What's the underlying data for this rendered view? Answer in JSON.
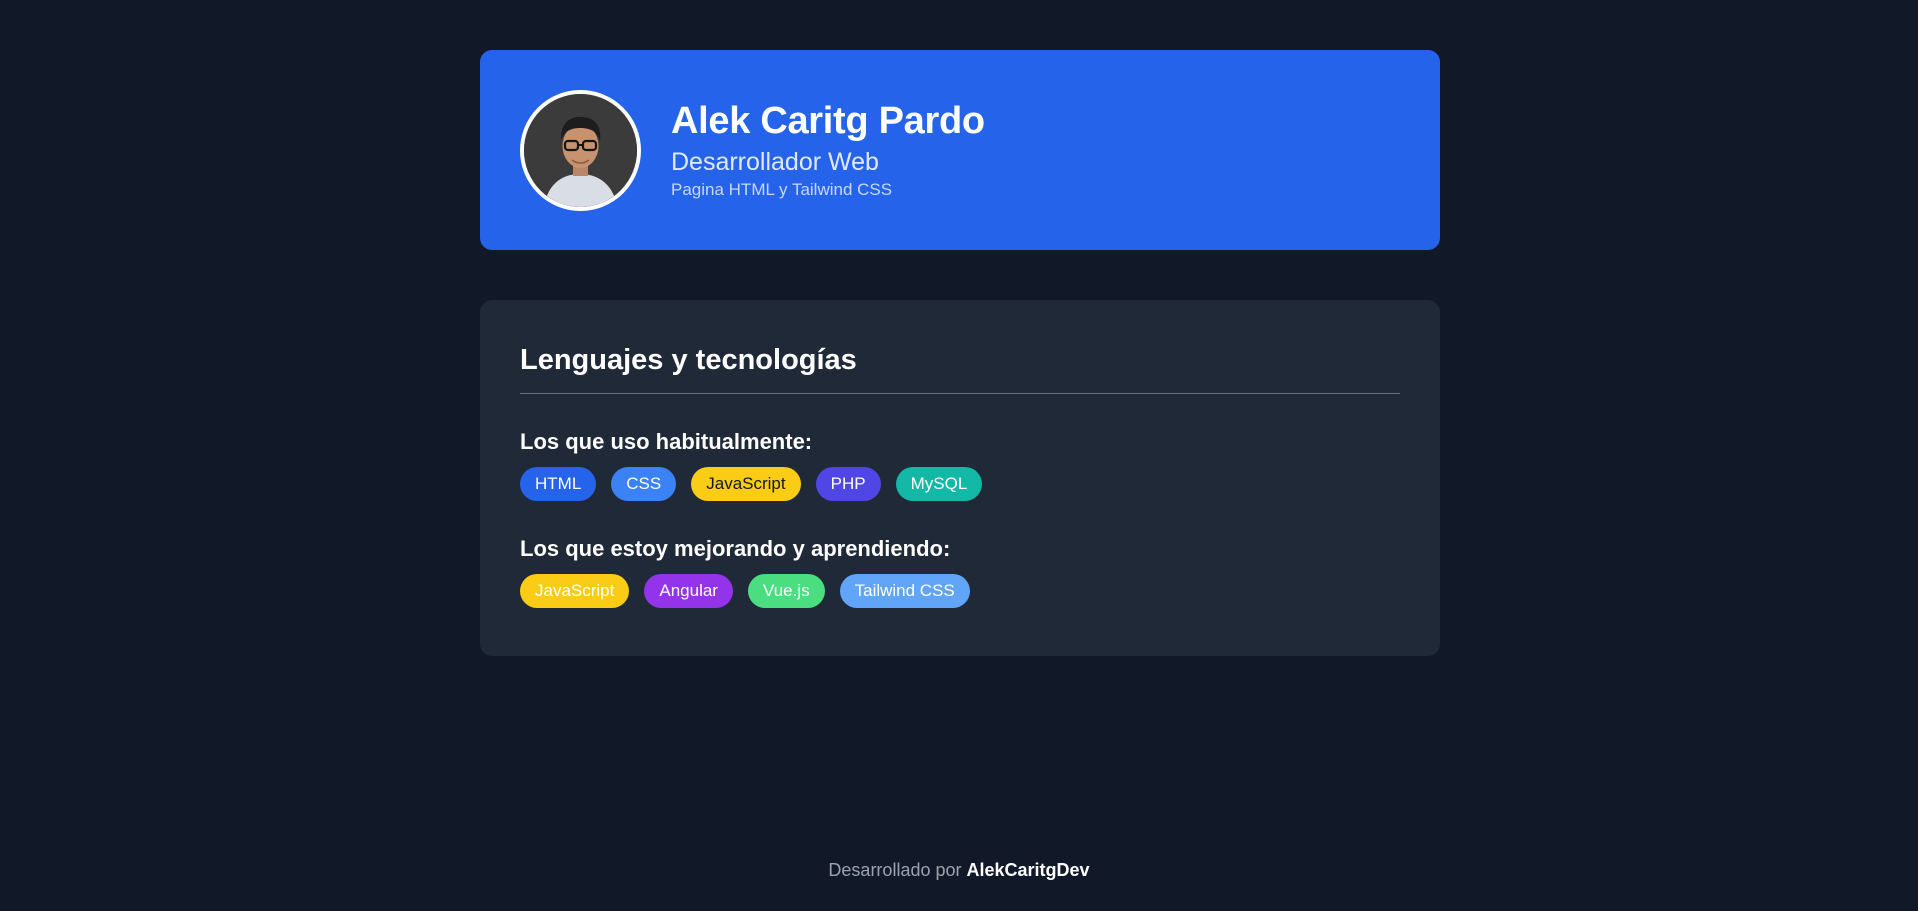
{
  "profile": {
    "name": "Alek Caritg Pardo",
    "role": "Desarrollador Web",
    "tagline": "Pagina HTML y Tailwind CSS"
  },
  "skills": {
    "title": "Lenguajes y tecnologías",
    "current_title": "Los que uso habitualmente:",
    "current": [
      {
        "label": "HTML",
        "color": "#2563eb"
      },
      {
        "label": "CSS",
        "color": "#3b82f6"
      },
      {
        "label": "JavaScript",
        "color": "#facc15"
      },
      {
        "label": "PHP",
        "color": "#4f46e5"
      },
      {
        "label": "MySQL",
        "color": "#14b8a6"
      }
    ],
    "learning_title": "Los que estoy mejorando y aprendiendo:",
    "learning": [
      {
        "label": "JavaScript",
        "color": "#facc15"
      },
      {
        "label": "Angular",
        "color": "#9333ea"
      },
      {
        "label": "Vue.js",
        "color": "#4ade80"
      },
      {
        "label": "Tailwind CSS",
        "color": "#60a5fa"
      }
    ]
  },
  "footer": {
    "prefix": "Desarrollado por",
    "author": "AlekCaritgDev"
  },
  "colors": {
    "background": "#111827",
    "profile_card": "#2563eb",
    "skills_card": "#1f2937"
  }
}
